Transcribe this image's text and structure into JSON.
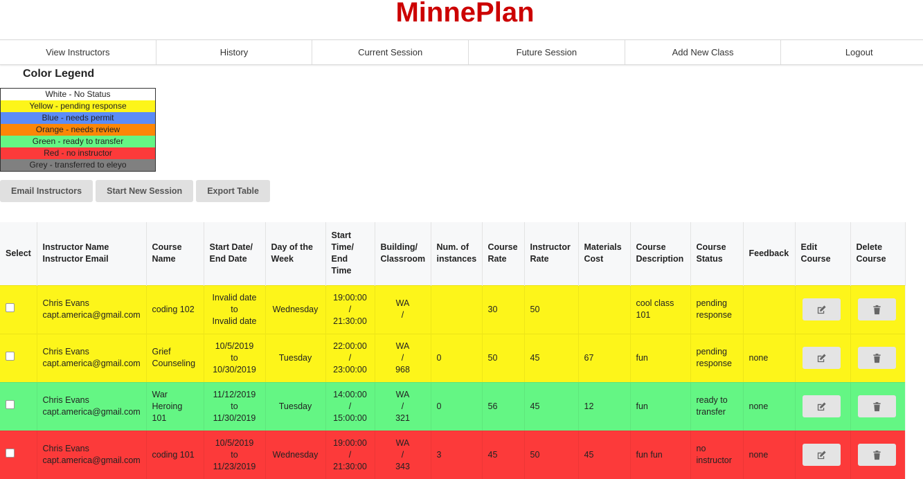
{
  "app": {
    "title": "MinnePlan"
  },
  "nav": [
    {
      "label": "View Instructors"
    },
    {
      "label": "History"
    },
    {
      "label": "Current Session"
    },
    {
      "label": "Future Session"
    },
    {
      "label": "Add New Class"
    },
    {
      "label": "Logout"
    }
  ],
  "legend": {
    "title": "Color Legend",
    "items": [
      {
        "label": "White - No Status",
        "color": "#ffffff"
      },
      {
        "label": "Yellow - pending response",
        "color": "#fdf51a"
      },
      {
        "label": "Blue - needs permit",
        "color": "#5b8cf7"
      },
      {
        "label": "Orange - needs review",
        "color": "#fc8707"
      },
      {
        "label": "Green - ready to transfer",
        "color": "#64f684"
      },
      {
        "label": "Red - no instructor",
        "color": "#fc3a3a"
      },
      {
        "label": "Grey - transferred to eleyo",
        "color": "#808080"
      }
    ]
  },
  "actions": {
    "email_label": "Email Instructors",
    "new_session_label": "Start New Session",
    "export_label": "Export Table"
  },
  "table": {
    "headers": {
      "select": "Select",
      "instructor": [
        "Instructor Name",
        "Instructor Email"
      ],
      "course_name": [
        "Course",
        "Name"
      ],
      "dates": [
        "Start Date/",
        "End Date"
      ],
      "day": [
        "Day of the",
        "Week"
      ],
      "time": [
        "Start",
        "Time/",
        "End",
        "Time"
      ],
      "building": [
        "Building/",
        "Classroom"
      ],
      "instances": [
        "Num. of",
        "instances"
      ],
      "course_rate": [
        "Course",
        "Rate"
      ],
      "instructor_rate": [
        "Instructor",
        "Rate"
      ],
      "materials": [
        "Materials",
        "Cost"
      ],
      "description": [
        "Course",
        "Description"
      ],
      "status": [
        "Course",
        "Status"
      ],
      "feedback": "Feedback",
      "edit": [
        "Edit",
        "Course"
      ],
      "delete": [
        "Delete",
        "Course"
      ]
    },
    "rows": [
      {
        "color": "#fdf51a",
        "name": "Chris Evans",
        "email": "capt.america@gmail.com",
        "course": "coding 102",
        "dates": [
          "Invalid date",
          "to",
          "Invalid date"
        ],
        "day": "Wednesday",
        "time": [
          "19:00:00",
          "/",
          "21:30:00"
        ],
        "building": [
          "WA",
          "/"
        ],
        "instances": "",
        "course_rate": "30",
        "instructor_rate": "50",
        "materials": "",
        "description": "cool class 101",
        "status": "pending response",
        "feedback": ""
      },
      {
        "color": "#fdf51a",
        "name": "Chris Evans",
        "email": "capt.america@gmail.com",
        "course": "Grief Counseling",
        "dates": [
          "10/5/2019",
          "to",
          "10/30/2019"
        ],
        "day": "Tuesday",
        "time": [
          "22:00:00",
          "/",
          "23:00:00"
        ],
        "building": [
          "WA",
          "/",
          "968"
        ],
        "instances": "0",
        "course_rate": "50",
        "instructor_rate": "45",
        "materials": "67",
        "description": "fun",
        "status": "pending response",
        "feedback": "none"
      },
      {
        "color": "#64f684",
        "name": "Chris Evans",
        "email": "capt.america@gmail.com",
        "course": "War Heroing 101",
        "dates": [
          "11/12/2019",
          "to",
          "11/30/2019"
        ],
        "day": "Tuesday",
        "time": [
          "14:00:00",
          "/",
          "15:00:00"
        ],
        "building": [
          "WA",
          "/",
          "321"
        ],
        "instances": "0",
        "course_rate": "56",
        "instructor_rate": "45",
        "materials": "12",
        "description": "fun",
        "status": "ready to transfer",
        "feedback": "none"
      },
      {
        "color": "#fc3a3a",
        "name": "Chris Evans",
        "email": "capt.america@gmail.com",
        "course": "coding 101",
        "dates": [
          "10/5/2019",
          "to",
          "11/23/2019"
        ],
        "day": "Wednesday",
        "time": [
          "19:00:00",
          "/",
          "21:30:00"
        ],
        "building": [
          "WA",
          "/",
          "343"
        ],
        "instances": "3",
        "course_rate": "45",
        "instructor_rate": "50",
        "materials": "45",
        "description": "fun fun",
        "status": "no instructor",
        "feedback": "none"
      }
    ]
  }
}
